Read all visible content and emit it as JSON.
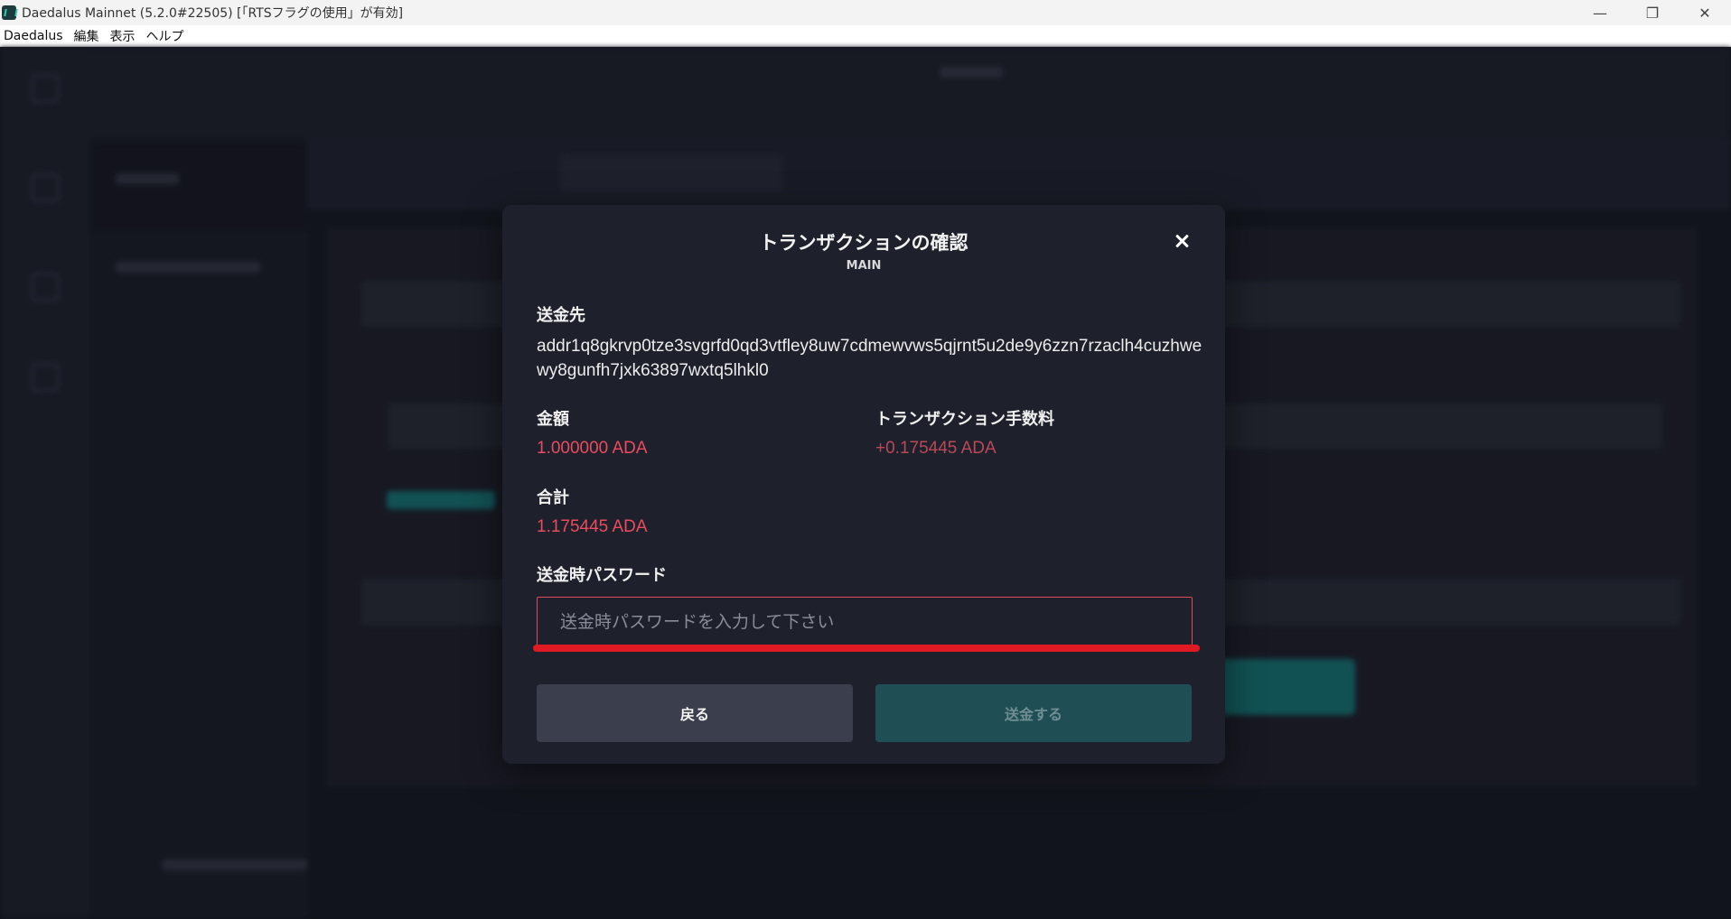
{
  "window": {
    "title": "Daedalus Mainnet (5.2.0#22505) [「RTSフラグの使用」が有効]",
    "controls": {
      "minimize": "—",
      "maximize": "❐",
      "close": "✕"
    }
  },
  "menu": [
    "Daedalus",
    "編集",
    "表示",
    "ヘルプ"
  ],
  "modal": {
    "title": "トランザクションの確認",
    "subtitle": "MAIN",
    "recipient_label": "送金先",
    "recipient_address": "addr1q8gkrvp0tze3svgrfd0qd3vtfley8uw7cdmewvws5qjrnt5u2de9y6zzn7rzaclh4cuzhwewy8gunfh7jxk63897wxtq5lhkl0",
    "amount_label": "金額",
    "amount_value": "1.000000 ADA",
    "fee_label": "トランザクション手数料",
    "fee_value": "+0.175445 ADA",
    "total_label": "合計",
    "total_value": "1.175445 ADA",
    "password_label": "送金時パスワード",
    "password_placeholder": "送金時パスワードを入力して下さい",
    "back_button": "戻る",
    "send_button": "送金する"
  },
  "colors": {
    "accent_red": "#ea4c5f",
    "teal": "#1fa8a7",
    "modal_bg": "#1e202c"
  }
}
